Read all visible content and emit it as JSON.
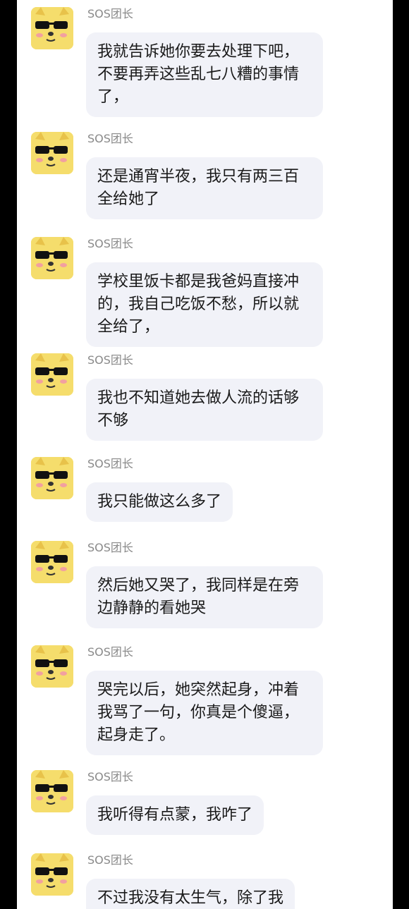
{
  "chat": {
    "messages": [
      {
        "sender": "SOS团长",
        "text": "我就告诉她你要去处理下吧，不要再弄这些乱七八糟的事情了，"
      },
      {
        "sender": "SOS团长",
        "text": "还是通宵半夜，我只有两三百全给她了"
      },
      {
        "sender": "SOS团长",
        "text": "学校里饭卡都是我爸妈直接冲的，我自己吃饭不愁，所以就全给了，"
      },
      {
        "sender": "SOS团长",
        "text": "我也不知道她去做人流的话够不够"
      },
      {
        "sender": "SOS团长",
        "text": "我只能做这么多了"
      },
      {
        "sender": "SOS团长",
        "text": "然后她又哭了，我同样是在旁边静静的看她哭"
      },
      {
        "sender": "SOS团长",
        "text": "哭完以后，她突然起身，冲着我骂了一句，你真是个傻逼，起身走了。"
      },
      {
        "sender": "SOS团长",
        "text": "我听得有点蒙，我咋了"
      },
      {
        "sender": "SOS团长",
        "text": "不过我没有太生气，除了我"
      }
    ]
  }
}
